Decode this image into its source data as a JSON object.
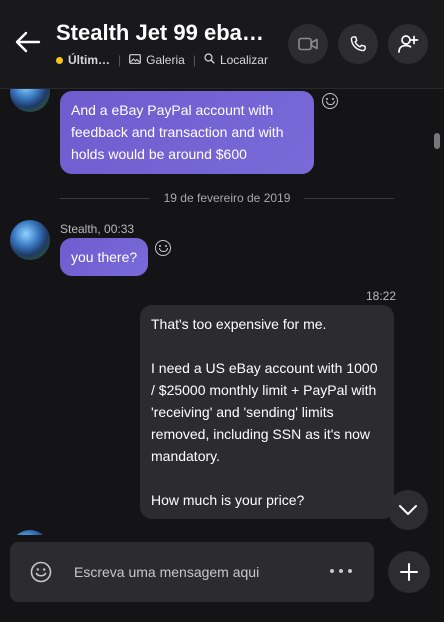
{
  "header": {
    "title": "Stealth Jet 99 eba…",
    "status_label": "Últim…",
    "gallery_label": "Galeria",
    "find_label": "Localizar",
    "status_color": "#f5c518"
  },
  "messages": {
    "first": {
      "text": "And a eBay PayPal account with feedback and transaction and with holds would be around $600"
    },
    "date_separator": "19 de fevereiro de 2019",
    "second": {
      "sender": "Stealth, 00:33",
      "text": "you there?"
    },
    "outgoing": {
      "time": "18:22",
      "paragraphs": [
        "That's too expensive for me.",
        "I need a US eBay account with 1000 / $25000 monthly limit + PayPal with 'receiving' and 'sending' limits removed, including SSN as it's now mandatory.",
        "How much is your price?"
      ]
    }
  },
  "composer": {
    "placeholder": "Escreva uma mensagem aqui"
  },
  "icons": {
    "back": "arrow-left-icon",
    "video": "video-camera-icon",
    "call": "phone-icon",
    "add_person": "add-person-icon",
    "gallery": "gallery-icon",
    "search": "search-icon",
    "emoji": "smile-icon",
    "more": "more-dots-icon",
    "plus": "plus-icon",
    "scroll_down": "chevron-down-icon"
  },
  "colors": {
    "incoming_bubble": "#7a6ad8",
    "outgoing_bubble": "#2b2b30",
    "background": "#141416"
  }
}
